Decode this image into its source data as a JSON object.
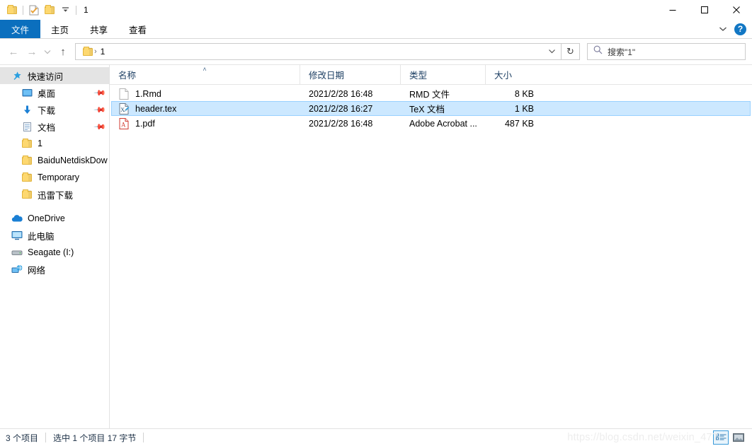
{
  "window": {
    "title": "1",
    "quick_access_icons": [
      "folder-icon",
      "properties-check-icon",
      "folder-icon",
      "chevron-down-icon"
    ],
    "controls": {
      "minimize": "─",
      "maximize": "□",
      "close": "✕"
    }
  },
  "ribbon": {
    "tabs": [
      {
        "label": "文件",
        "active": true
      },
      {
        "label": "主页",
        "active": false
      },
      {
        "label": "共享",
        "active": false
      },
      {
        "label": "查看",
        "active": false
      }
    ],
    "expand_icon": "chevron-down-icon",
    "help_label": "?"
  },
  "address": {
    "back_icon": "←",
    "forward_icon": "→",
    "recent_icon": "⌄",
    "up_icon": "↑",
    "crumb_folder_icon": "folder-icon",
    "crumb": "1",
    "crumb_separator": "›",
    "dropdown_icon": "⌄",
    "refresh_icon": "↻"
  },
  "search": {
    "icon": "search-icon",
    "placeholder": "搜索\"1\""
  },
  "sidebar": {
    "items": [
      {
        "label": "快速访问",
        "icon": "star-pin-icon",
        "selected": true,
        "indent": false,
        "pinned": false
      },
      {
        "label": "桌面",
        "icon": "desktop-icon",
        "selected": false,
        "indent": true,
        "pinned": true
      },
      {
        "label": "下载",
        "icon": "download-icon",
        "selected": false,
        "indent": true,
        "pinned": true
      },
      {
        "label": "文档",
        "icon": "documents-icon",
        "selected": false,
        "indent": true,
        "pinned": true
      },
      {
        "label": "1",
        "icon": "folder-icon",
        "selected": false,
        "indent": true,
        "pinned": false
      },
      {
        "label": "BaiduNetdiskDow",
        "icon": "folder-icon",
        "selected": false,
        "indent": true,
        "pinned": false
      },
      {
        "label": "Temporary",
        "icon": "folder-icon",
        "selected": false,
        "indent": true,
        "pinned": false
      },
      {
        "label": "迅雷下载",
        "icon": "folder-icon",
        "selected": false,
        "indent": true,
        "pinned": false
      }
    ],
    "roots": [
      {
        "label": "OneDrive",
        "icon": "cloud-icon"
      },
      {
        "label": "此电脑",
        "icon": "this-pc-icon"
      },
      {
        "label": "Seagate (I:)",
        "icon": "drive-icon"
      },
      {
        "label": "网络",
        "icon": "network-icon"
      }
    ]
  },
  "filelist": {
    "columns": [
      {
        "label": "名称",
        "sorted": true,
        "sort_caret": "˄"
      },
      {
        "label": "修改日期",
        "sorted": false,
        "sort_caret": ""
      },
      {
        "label": "类型",
        "sorted": false,
        "sort_caret": ""
      },
      {
        "label": "大小",
        "sorted": false,
        "sort_caret": ""
      }
    ],
    "rows": [
      {
        "name": "1.Rmd",
        "date": "2021/2/28 16:48",
        "type": "RMD 文件",
        "size": "8 KB",
        "icon": "blank-document-icon",
        "selected": false
      },
      {
        "name": "header.tex",
        "date": "2021/2/28 16:27",
        "type": "TeX 文档",
        "size": "1 KB",
        "icon": "tex-document-icon",
        "selected": true
      },
      {
        "name": "1.pdf",
        "date": "2021/2/28 16:48",
        "type": "Adobe Acrobat ...",
        "size": "487 KB",
        "icon": "pdf-document-icon",
        "selected": false
      }
    ]
  },
  "statusbar": {
    "item_count": "3 个项目",
    "selection_info": "选中 1 个项目  17 字节",
    "watermark": "https://blog.csdn.net/weixin_477",
    "views": [
      {
        "name": "details-view-button",
        "active": true
      },
      {
        "name": "large-icons-view-button",
        "active": false
      }
    ]
  },
  "colors": {
    "accent": "#0b6fbe",
    "selection": "#cce8ff",
    "selection_border": "#99d1ff",
    "folder": "#fdd870"
  }
}
